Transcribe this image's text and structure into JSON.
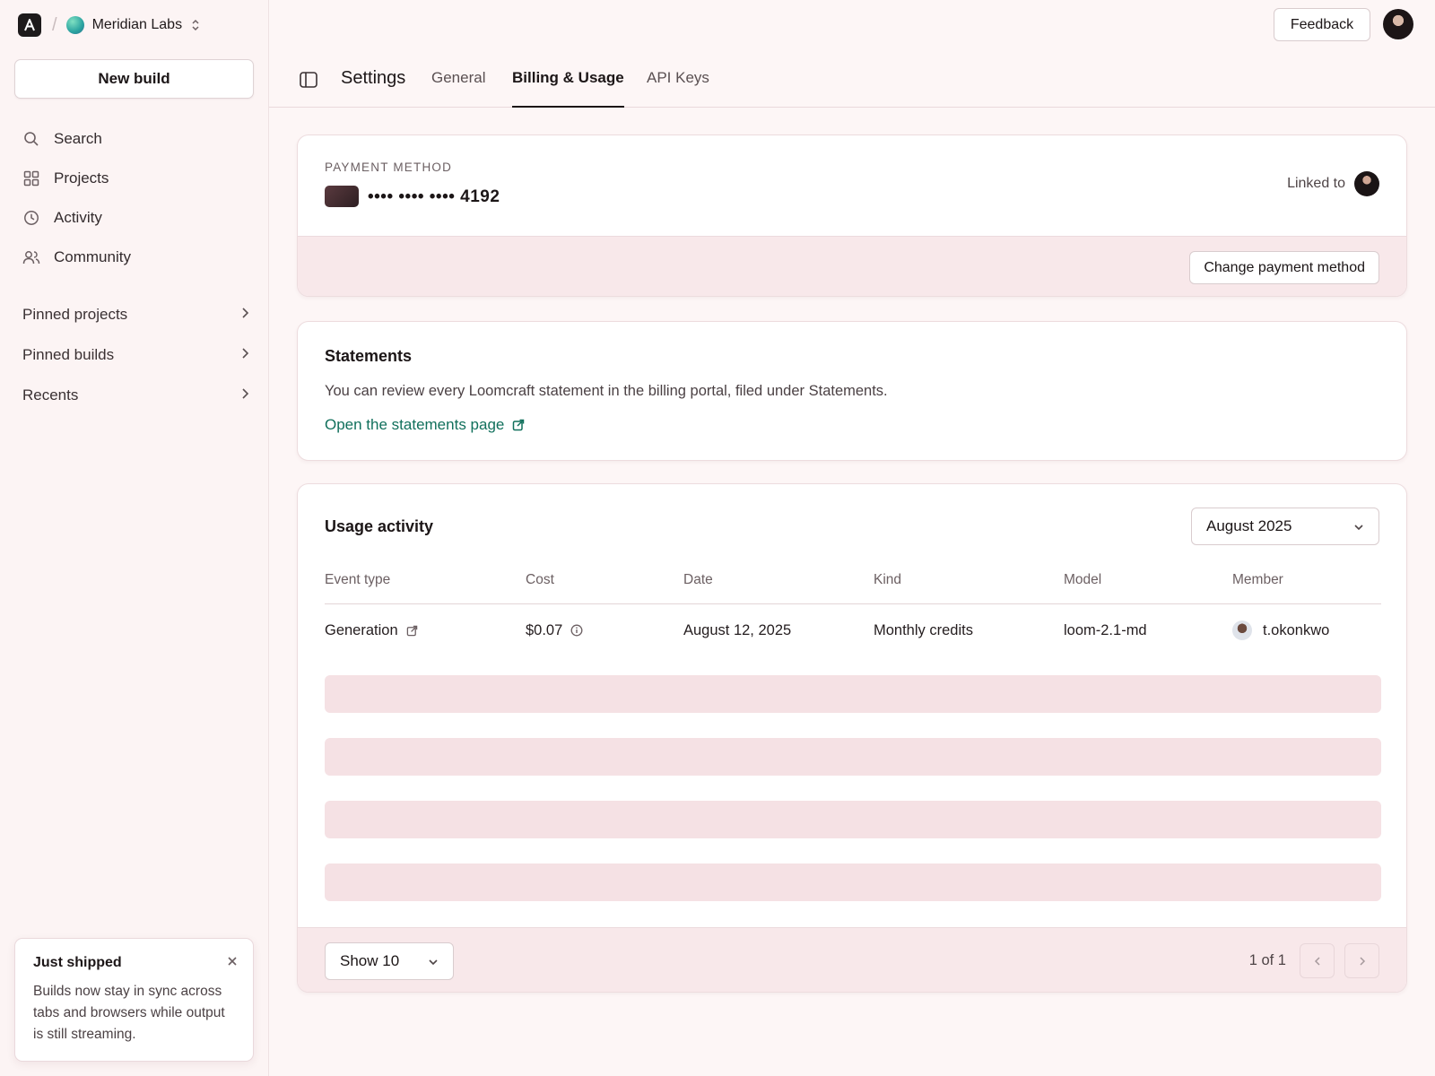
{
  "sidebar": {
    "org_name": "Meridian Labs",
    "new_build_label": "New build",
    "nav": [
      {
        "label": "Search",
        "icon": "search-icon"
      },
      {
        "label": "Projects",
        "icon": "grid-icon"
      },
      {
        "label": "Activity",
        "icon": "clock-icon"
      },
      {
        "label": "Community",
        "icon": "users-icon"
      }
    ],
    "pinned": [
      {
        "label": "Pinned projects"
      },
      {
        "label": "Pinned builds"
      },
      {
        "label": "Recents"
      }
    ],
    "toast": {
      "title": "Just shipped",
      "body": "Builds now stay in sync across tabs and browsers while output is still streaming."
    }
  },
  "header": {
    "feedback_label": "Feedback",
    "settings_title": "Settings",
    "tabs": [
      {
        "label": "General",
        "active": false
      },
      {
        "label": "Billing & Usage",
        "active": true
      },
      {
        "label": "API Keys",
        "active": false
      }
    ]
  },
  "payment": {
    "kicker": "PAYMENT METHOD",
    "card_number": "•••• •••• •••• 4192",
    "linked_label": "Linked to",
    "change_label": "Change payment method"
  },
  "statements": {
    "title": "Statements",
    "description": "You can review every Loomcraft statement in the billing portal, filed under Statements.",
    "link_label": "Open the statements page"
  },
  "usage": {
    "title": "Usage activity",
    "month": "August 2025",
    "columns": [
      "Event type",
      "Cost",
      "Date",
      "Kind",
      "Model",
      "Member"
    ],
    "rows": [
      {
        "event": "Generation",
        "cost": "$0.07",
        "date": "August 12, 2025",
        "kind": "Monthly credits",
        "model": "loom-2.1-md",
        "member": "t.okonkwo"
      }
    ],
    "show_label": "Show 10",
    "page_info": "1 of 1"
  },
  "colors": {
    "background": "#fdf6f6",
    "accent_link": "#11705c",
    "panel_tint": "#f8e8ea",
    "skeleton": "#f5e1e4"
  }
}
